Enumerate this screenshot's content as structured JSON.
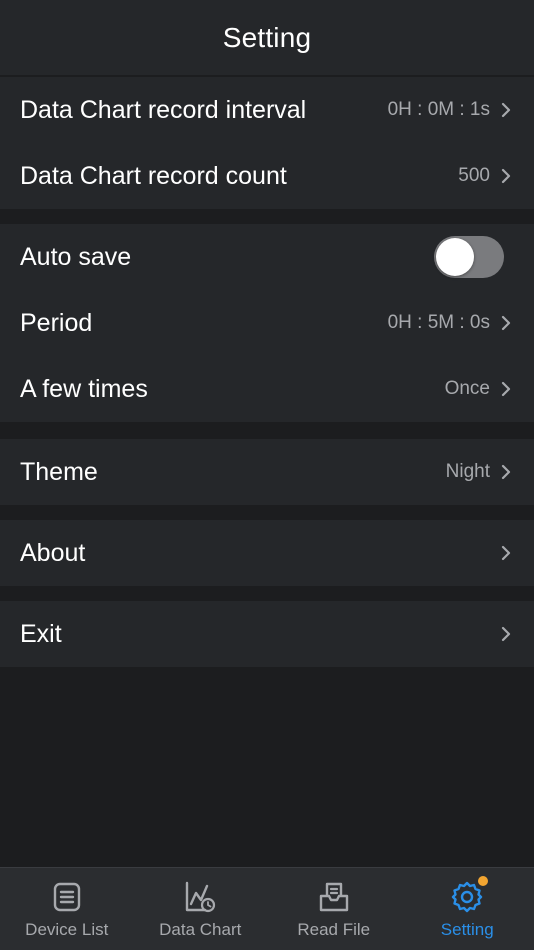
{
  "header": {
    "title": "Setting"
  },
  "chart_group": {
    "record_interval": {
      "label": "Data Chart record interval",
      "value": "0H : 0M : 1s"
    },
    "record_count": {
      "label": "Data Chart record count",
      "value": "500"
    }
  },
  "save_group": {
    "auto_save": {
      "label": "Auto save",
      "enabled": false
    },
    "period": {
      "label": "Period",
      "value": "0H : 5M : 0s"
    },
    "few_times": {
      "label": "A few times",
      "value": "Once"
    }
  },
  "theme": {
    "label": "Theme",
    "value": "Night"
  },
  "about": {
    "label": "About"
  },
  "exit": {
    "label": "Exit"
  },
  "tabbar": {
    "tabs": [
      {
        "label": "Device List",
        "icon": "device-list-icon"
      },
      {
        "label": "Data Chart",
        "icon": "data-chart-icon"
      },
      {
        "label": "Read File",
        "icon": "read-file-icon"
      },
      {
        "label": "Setting",
        "icon": "gear-icon",
        "active": true
      }
    ]
  },
  "colors": {
    "background": "#1c1d1f",
    "panel": "#25272a",
    "accent": "#2a8fe8",
    "badge": "#f2a531",
    "secondary_text": "#a7a9ad"
  }
}
